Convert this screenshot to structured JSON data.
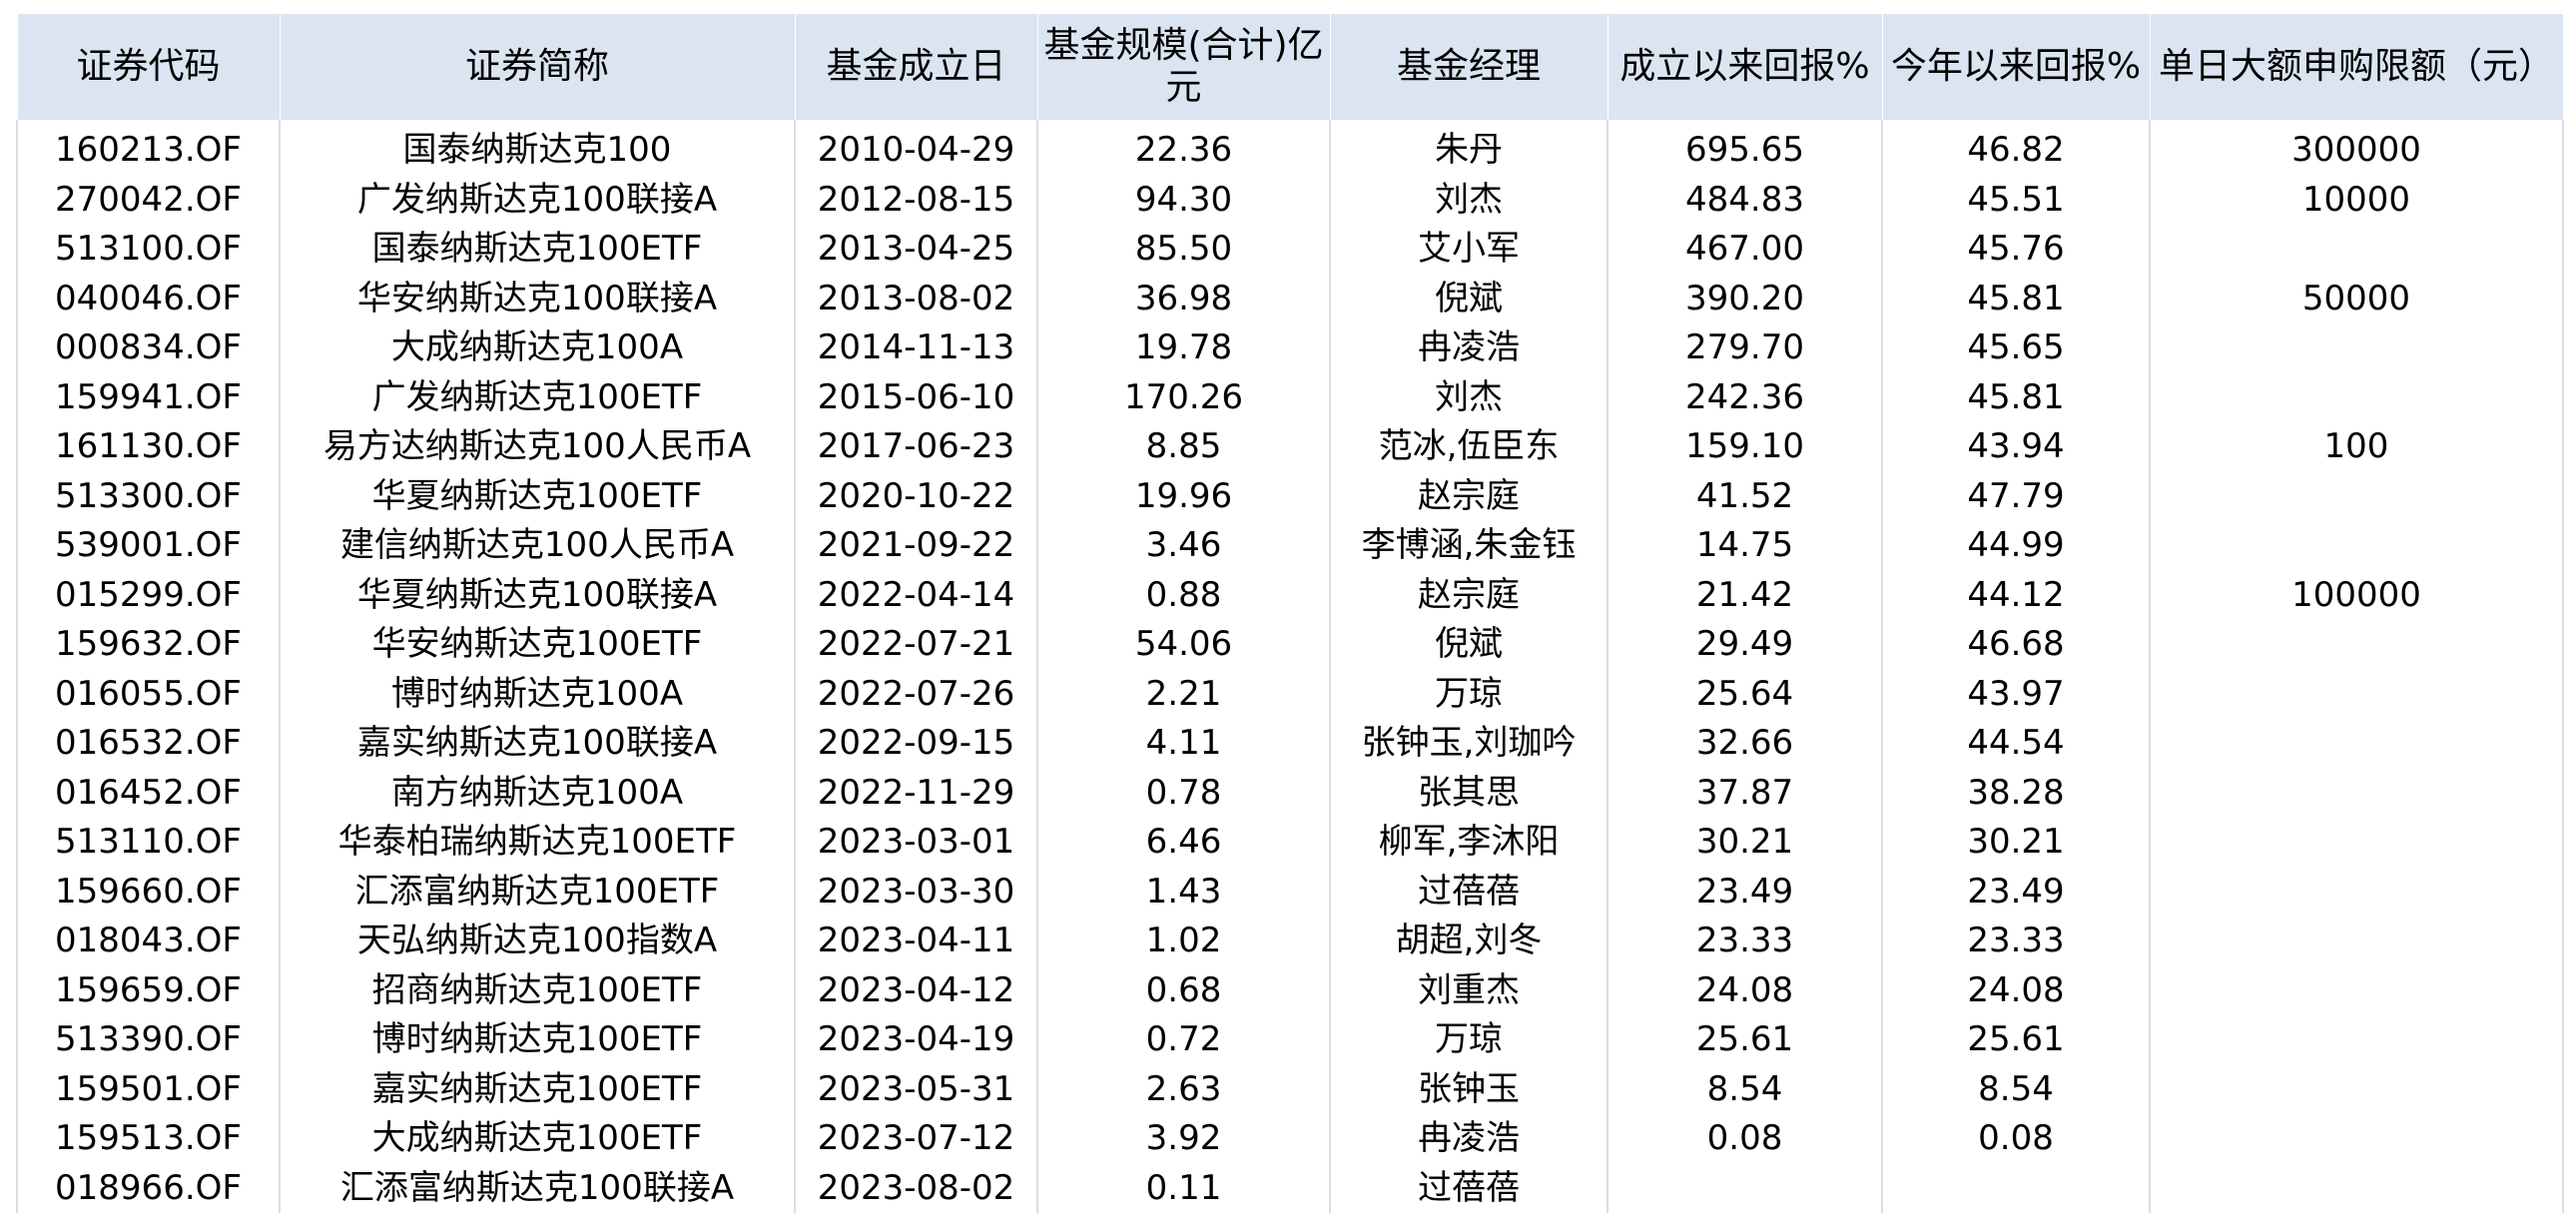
{
  "table": {
    "columns": [
      {
        "key": "code",
        "label": "证券代码"
      },
      {
        "key": "name",
        "label": "证券简称"
      },
      {
        "key": "inception",
        "label": "基金成立日"
      },
      {
        "key": "scale",
        "label": "基金规模(合计)亿元"
      },
      {
        "key": "manager",
        "label": "基金经理"
      },
      {
        "key": "return_since",
        "label": "成立以来回报%"
      },
      {
        "key": "return_ytd",
        "label": "今年以来回报%"
      },
      {
        "key": "limit",
        "label": "单日大额申购限额（元）"
      }
    ],
    "rows": [
      [
        "160213.OF",
        "国泰纳斯达克100",
        "2010-04-29",
        "22.36",
        "朱丹",
        "695.65",
        "46.82",
        "300000"
      ],
      [
        "270042.OF",
        "广发纳斯达克100联接A",
        "2012-08-15",
        "94.30",
        "刘杰",
        "484.83",
        "45.51",
        "10000"
      ],
      [
        "513100.OF",
        "国泰纳斯达克100ETF",
        "2013-04-25",
        "85.50",
        "艾小军",
        "467.00",
        "45.76",
        ""
      ],
      [
        "040046.OF",
        "华安纳斯达克100联接A",
        "2013-08-02",
        "36.98",
        "倪斌",
        "390.20",
        "45.81",
        "50000"
      ],
      [
        "000834.OF",
        "大成纳斯达克100A",
        "2014-11-13",
        "19.78",
        "冉凌浩",
        "279.70",
        "45.65",
        ""
      ],
      [
        "159941.OF",
        "广发纳斯达克100ETF",
        "2015-06-10",
        "170.26",
        "刘杰",
        "242.36",
        "45.81",
        ""
      ],
      [
        "161130.OF",
        "易方达纳斯达克100人民币A",
        "2017-06-23",
        "8.85",
        "范冰,伍臣东",
        "159.10",
        "43.94",
        "100"
      ],
      [
        "513300.OF",
        "华夏纳斯达克100ETF",
        "2020-10-22",
        "19.96",
        "赵宗庭",
        "41.52",
        "47.79",
        ""
      ],
      [
        "539001.OF",
        "建信纳斯达克100人民币A",
        "2021-09-22",
        "3.46",
        "李博涵,朱金钰",
        "14.75",
        "44.99",
        ""
      ],
      [
        "015299.OF",
        "华夏纳斯达克100联接A",
        "2022-04-14",
        "0.88",
        "赵宗庭",
        "21.42",
        "44.12",
        "100000"
      ],
      [
        "159632.OF",
        "华安纳斯达克100ETF",
        "2022-07-21",
        "54.06",
        "倪斌",
        "29.49",
        "46.68",
        ""
      ],
      [
        "016055.OF",
        "博时纳斯达克100A",
        "2022-07-26",
        "2.21",
        "万琼",
        "25.64",
        "43.97",
        ""
      ],
      [
        "016532.OF",
        "嘉实纳斯达克100联接A",
        "2022-09-15",
        "4.11",
        "张钟玉,刘珈吟",
        "32.66",
        "44.54",
        ""
      ],
      [
        "016452.OF",
        "南方纳斯达克100A",
        "2022-11-29",
        "0.78",
        "张其思",
        "37.87",
        "38.28",
        ""
      ],
      [
        "513110.OF",
        "华泰柏瑞纳斯达克100ETF",
        "2023-03-01",
        "6.46",
        "柳军,李沐阳",
        "30.21",
        "30.21",
        ""
      ],
      [
        "159660.OF",
        "汇添富纳斯达克100ETF",
        "2023-03-30",
        "1.43",
        "过蓓蓓",
        "23.49",
        "23.49",
        ""
      ],
      [
        "018043.OF",
        "天弘纳斯达克100指数A",
        "2023-04-11",
        "1.02",
        "胡超,刘冬",
        "23.33",
        "23.33",
        ""
      ],
      [
        "159659.OF",
        "招商纳斯达克100ETF",
        "2023-04-12",
        "0.68",
        "刘重杰",
        "24.08",
        "24.08",
        ""
      ],
      [
        "513390.OF",
        "博时纳斯达克100ETF",
        "2023-04-19",
        "0.72",
        "万琼",
        "25.61",
        "25.61",
        ""
      ],
      [
        "159501.OF",
        "嘉实纳斯达克100ETF",
        "2023-05-31",
        "2.63",
        "张钟玉",
        "8.54",
        "8.54",
        ""
      ],
      [
        "159513.OF",
        "大成纳斯达克100ETF",
        "2023-07-12",
        "3.92",
        "冉凌浩",
        "0.08",
        "0.08",
        ""
      ],
      [
        "018966.OF",
        "汇添富纳斯达克100联接A",
        "2023-08-02",
        "0.11",
        "过蓓蓓",
        "",
        "",
        ""
      ]
    ]
  }
}
